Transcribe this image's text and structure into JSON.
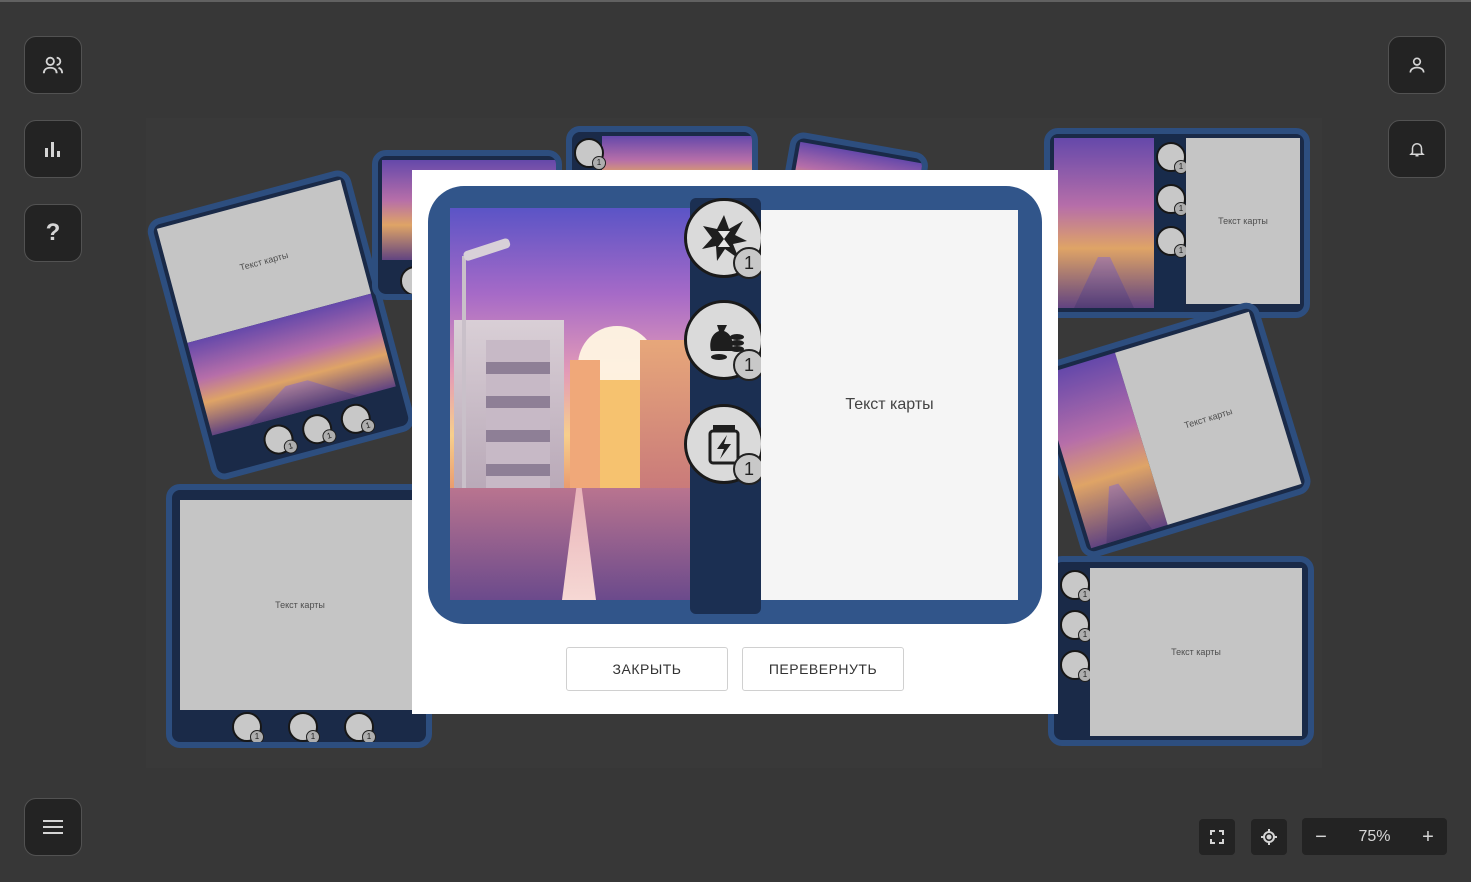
{
  "sidebar_left": {
    "players_icon": "users-icon",
    "stats_icon": "bar-chart-icon",
    "help_label": "?",
    "menu_icon": "hamburger-menu-icon"
  },
  "sidebar_right": {
    "profile_icon": "user-icon",
    "notifications_icon": "bell-icon"
  },
  "bottom_controls": {
    "fullscreen_icon": "fullscreen-icon",
    "center_icon": "locate-icon",
    "zoom_out_label": "−",
    "zoom_level": "75%",
    "zoom_in_label": "+"
  },
  "board": {
    "card_text": "Текст карты",
    "card_count": 9
  },
  "modal": {
    "card_text": "Текст карты",
    "resources": [
      {
        "icon": "explosion-timer-icon",
        "count": "1"
      },
      {
        "icon": "money-bag-coins-icon",
        "count": "1"
      },
      {
        "icon": "energy-jar-icon",
        "count": "1"
      }
    ],
    "close_label": "ЗАКРЫТЬ",
    "flip_label": "ПЕРЕВЕРНУТЬ"
  },
  "colors": {
    "background": "#3c3c3c",
    "card_border": "#31558a",
    "card_strip": "#1b2f52",
    "button_dark": "#262626"
  }
}
